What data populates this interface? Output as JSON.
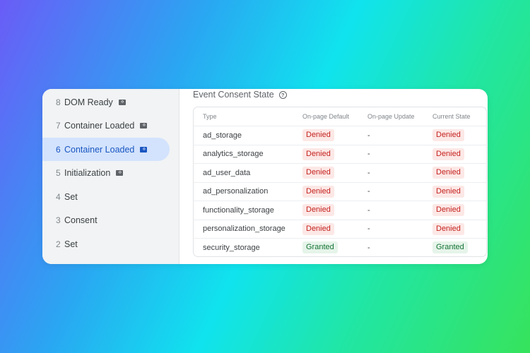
{
  "sidebar": {
    "items": [
      {
        "num": "8",
        "label": "DOM Ready",
        "icon": "tag-icon"
      },
      {
        "num": "7",
        "label": "Container Loaded",
        "icon": "tag-icon"
      },
      {
        "num": "6",
        "label": "Container Loaded",
        "icon": "tag-icon",
        "active": true
      },
      {
        "num": "5",
        "label": "Initialization",
        "icon": "tag-icon"
      },
      {
        "num": "4",
        "label": "Set"
      },
      {
        "num": "3",
        "label": "Consent"
      },
      {
        "num": "2",
        "label": "Set"
      }
    ]
  },
  "main": {
    "title": "Event Consent State",
    "table": {
      "headers": [
        "Type",
        "On-page Default",
        "On-page Update",
        "Current State"
      ],
      "rows": [
        {
          "type": "ad_storage",
          "default": "Denied",
          "update": "-",
          "current": "Denied"
        },
        {
          "type": "analytics_storage",
          "default": "Denied",
          "update": "-",
          "current": "Denied"
        },
        {
          "type": "ad_user_data",
          "default": "Denied",
          "update": "-",
          "current": "Denied"
        },
        {
          "type": "ad_personalization",
          "default": "Denied",
          "update": "-",
          "current": "Denied"
        },
        {
          "type": "functionality_storage",
          "default": "Denied",
          "update": "-",
          "current": "Denied"
        },
        {
          "type": "personalization_storage",
          "default": "Denied",
          "update": "-",
          "current": "Denied"
        },
        {
          "type": "security_storage",
          "default": "Granted",
          "update": "-",
          "current": "Granted"
        }
      ]
    }
  },
  "colors": {
    "denied_bg": "#fce8e6",
    "denied_text": "#c5221f",
    "granted_bg": "#e6f4ea",
    "granted_text": "#137333",
    "active_bg": "#d3e3fd",
    "active_text": "#1a56c2"
  }
}
